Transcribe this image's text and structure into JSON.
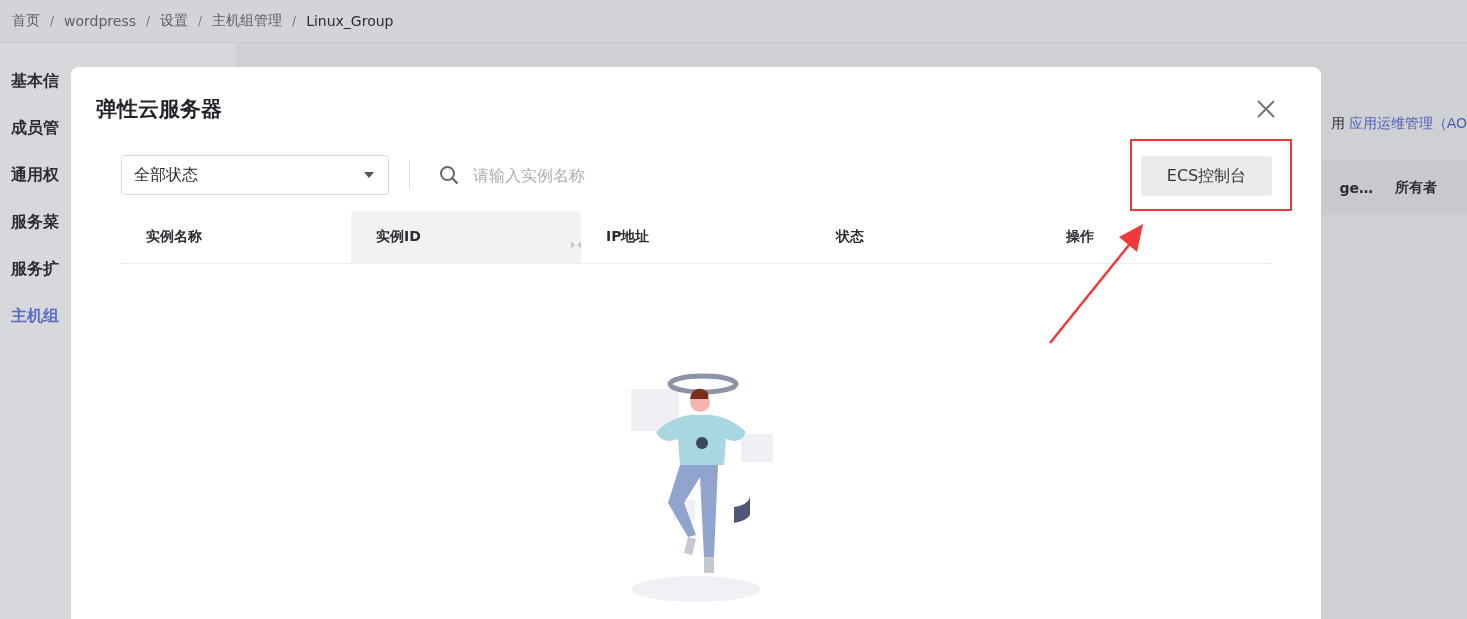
{
  "breadcrumb": {
    "separator": "/",
    "items": [
      {
        "label": "首页",
        "current": false
      },
      {
        "label": "wordpress",
        "current": false
      },
      {
        "label": "设置",
        "current": false
      },
      {
        "label": "主机组管理",
        "current": false
      },
      {
        "label": "Linux_Group",
        "current": true
      }
    ]
  },
  "sidebar": {
    "items": [
      {
        "label": "基本信",
        "selected": false
      },
      {
        "label": "成员管",
        "selected": false
      },
      {
        "label": "通用权",
        "selected": false
      },
      {
        "label": "服务菜",
        "selected": false
      },
      {
        "label": "服务扩",
        "selected": false
      },
      {
        "label": "主机组",
        "selected": true
      }
    ]
  },
  "background": {
    "notice_text": "用",
    "notice_link": "应用运维管理（AO",
    "table_columns": [
      "ge…",
      "所有者"
    ]
  },
  "dialog": {
    "title": "弹性云服务器",
    "status_select": {
      "value": "全部状态"
    },
    "search": {
      "placeholder": "请输入实例名称"
    },
    "console_button": "ECS控制台",
    "table": {
      "columns": [
        {
          "label": "实例名称",
          "selected": false
        },
        {
          "label": "实例ID",
          "selected": true
        },
        {
          "label": "IP地址",
          "selected": false
        },
        {
          "label": "状态",
          "selected": false
        },
        {
          "label": "操作",
          "selected": false
        }
      ]
    }
  }
}
